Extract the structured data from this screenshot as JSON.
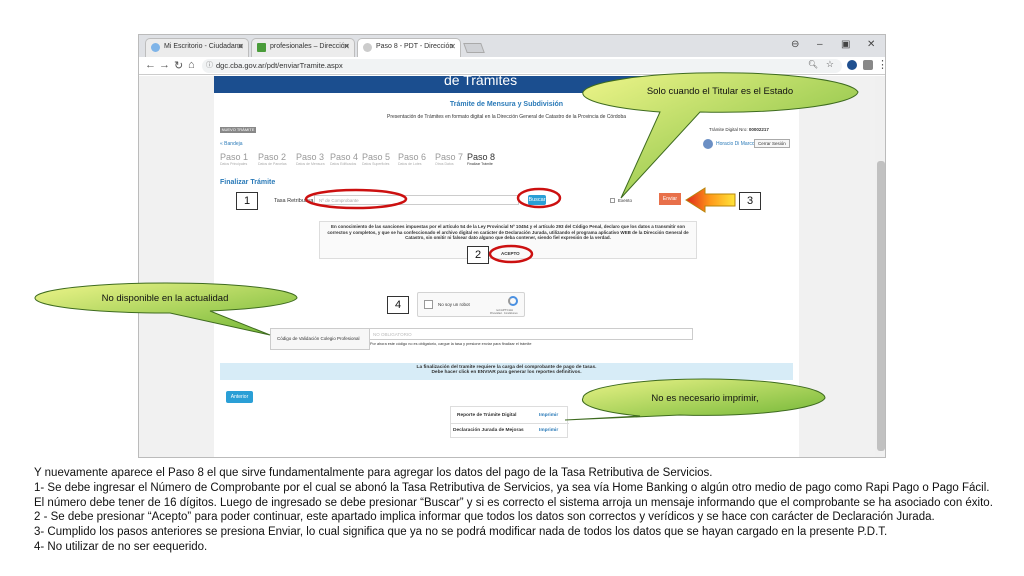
{
  "browser": {
    "tabs": [
      {
        "label": "Mi Escritorio - Ciudadano"
      },
      {
        "label": "profesionales – Dirección"
      },
      {
        "label": "Paso 8 - PDT - Dirección"
      }
    ],
    "url": "dgc.cba.gov.ar/pdt/enviarTramite.aspx"
  },
  "page": {
    "banner": "de Trámites",
    "heading": "Trámite de Mensura y Subdivisión",
    "subheading": "Presentación de Trámites en formato digital en la Dirección General de Catastro de la Provincia de Córdoba",
    "badge": "NUEVO TRÁMITE",
    "tramite_label": "Trámite Digital Nro:",
    "tramite_nro": "00002217",
    "user": "Horacio Di Marco",
    "logout": "Cerrar Sesión",
    "back_link": "« Bandeja",
    "steps": [
      {
        "label": "Paso 1",
        "sub": "Datos Principales"
      },
      {
        "label": "Paso 2",
        "sub": "Datos de Parcelas"
      },
      {
        "label": "Paso 3",
        "sub": "Datos de Mensura"
      },
      {
        "label": "Paso 4",
        "sub": "Datos Edificados"
      },
      {
        "label": "Paso 5",
        "sub": "Datos Superficies"
      },
      {
        "label": "Paso 6",
        "sub": "Datos de Lotes"
      },
      {
        "label": "Paso 7",
        "sub": "Otros Datos"
      },
      {
        "label": "Paso 8",
        "sub": "Finalizar Trámite"
      }
    ],
    "section_title": "Finalizar Trámite",
    "tasa_label": "Tasa Retributiva",
    "comprobante_placeholder": "Nº de Comprobante",
    "buscar_button": "Buscar",
    "exento_label": "Exento",
    "enviar_button": "Enviar",
    "declaracion": "En conocimiento de las sanciones impuestas por el artículo 54 de la Ley Provincial Nº 10454 y el artículo 293 del Código Penal, declaro que los datos a transmitir son correctos y completos, y que se ha confeccionado el archivo digital en carácter de Declaración Jurada, utilizando el programa aplicativo WEB de la Dirección General de Catastro, sin omitir ni falsear dato alguno que deba contener, siendo fiel expresión de la verdad.",
    "acepto_label": "ACEPTO",
    "captcha_label": "No soy un robot",
    "captcha_brand": "reCAPTCHA",
    "captcha_links": "Privacidad · Condiciones",
    "codigo_label": "Código de Validación Colegio Profesional",
    "codigo_placeholder": "NO OBLIGATORIO",
    "codigo_help": "Por ahora este código no es obligatorio, cargue la tasa y presione enviar para finalizar el trámite",
    "notice_line1": "La finalización del tramite requiere la carga del comprobante de pago de tasas.",
    "notice_line2": "Debe hacer click en ENVIAR para generar los reportes definitivos.",
    "anterior_button": "Anterior",
    "reports": [
      {
        "name": "Reporte de Trámite Digital",
        "action": "Imprimir"
      },
      {
        "name": "Declaración Jurada de Mejoras",
        "action": "Imprimir"
      }
    ]
  },
  "annotations": {
    "callout_titular": "Solo cuando el Titular es el Estado",
    "callout_no_disponible": "No disponible en la actualidad",
    "callout_imprimir": "No es necesario imprimir,",
    "num1": "1",
    "num2": "2",
    "num3": "3",
    "num4": "4"
  },
  "caption": [
    "Y nuevamente aparece el Paso 8 el que sirve fundamentalmente para agregar los datos del pago de la Tasa Retributiva de Servicios.",
    "1- Se debe ingresar el Número de Comprobante por el cual se abonó la Tasa Retributiva de Servicios, ya sea vía Home Banking o algún otro medio de pago como Rapi Pago o Pago Fácil. El número debe tener de 16 dígitos. Luego de ingresado se debe presionar “Buscar” y si es correcto el sistema arroja un mensaje informando que el comprobante se ha asociado con éxito.",
    "2 - Se debe presionar “Acepto” para poder continuar, este apartado implica informar que todos los datos son correctos y verídicos y se hace con carácter de Declaración Jurada.",
    "3- Cumplido los pasos anteriores se presiona Enviar, lo cual significa que ya no se podrá modificar nada de todos los datos que se hayan cargado en la presente P.D.T.",
    "4- No utilizar de no ser eequerido."
  ],
  "colors": {
    "accent": "#2a9fd6",
    "banner": "#1b4e8f",
    "highlight": "#cc1010",
    "enviar": "#e8704a"
  }
}
